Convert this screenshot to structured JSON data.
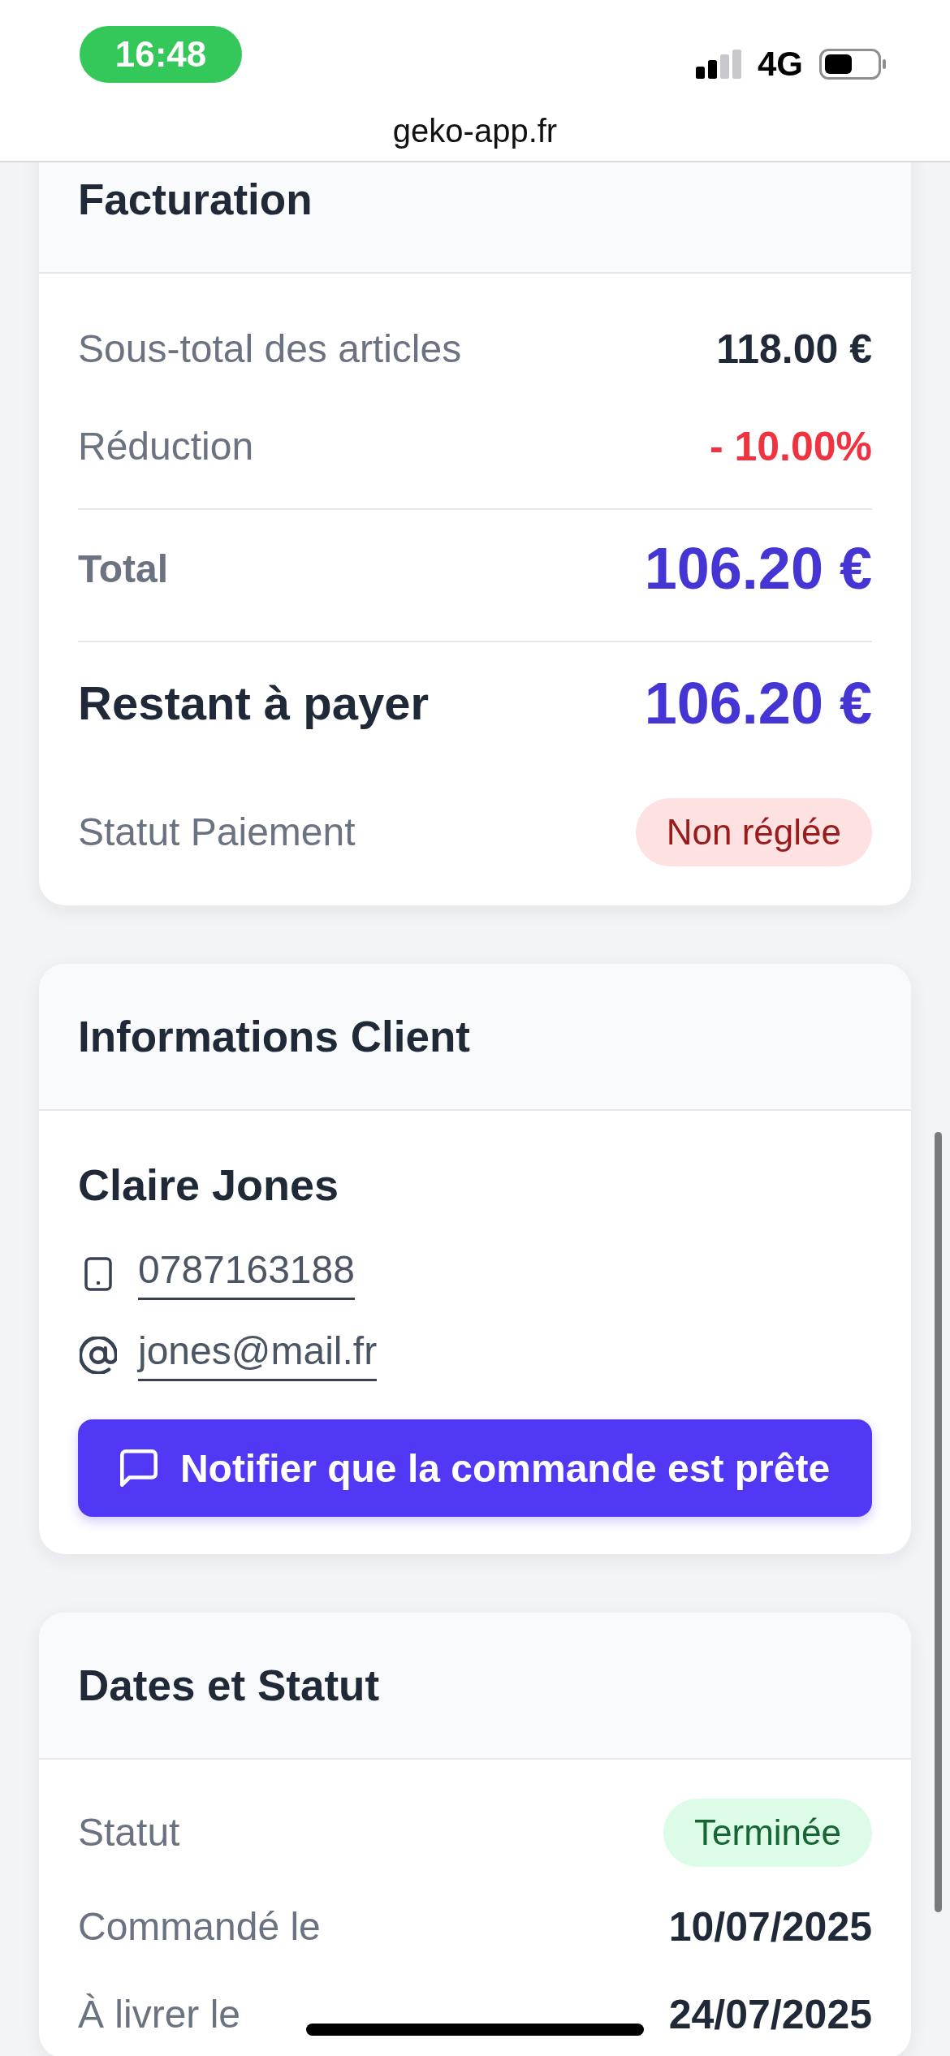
{
  "status_bar": {
    "time": "16:48",
    "network": "4G"
  },
  "browser": {
    "url": "geko-app.fr"
  },
  "billing": {
    "title": "Facturation",
    "rows": [
      {
        "kind": "line",
        "label": "Sous-total des articles",
        "value": "118.00 €"
      },
      {
        "kind": "discount",
        "label": "Réduction",
        "value": "- 10.00%"
      },
      {
        "kind": "total",
        "label": "Total",
        "value": "106.20 €"
      },
      {
        "kind": "due",
        "label": "Restant à payer",
        "value": "106.20 €"
      },
      {
        "kind": "badge",
        "label": "Statut Paiement",
        "value": "Non réglée",
        "color": "#fee2e2"
      }
    ]
  },
  "client": {
    "title": "Informations Client",
    "name": "Claire Jones",
    "contacts": [
      {
        "kind": "phone",
        "value": "0787163188"
      },
      {
        "kind": "email",
        "value": "jones@mail.fr"
      }
    ],
    "button": {
      "label": "Notifier que la commande est prête"
    }
  },
  "dates": {
    "title": "Dates et Statut",
    "rows": [
      {
        "kind": "badge",
        "label": "Statut",
        "value": "Terminée",
        "color": "#dcfce7"
      },
      {
        "kind": "date",
        "label": "Commandé le",
        "value": "10/07/2025"
      },
      {
        "kind": "date",
        "label": "À livrer le",
        "value": "24/07/2025"
      }
    ]
  }
}
